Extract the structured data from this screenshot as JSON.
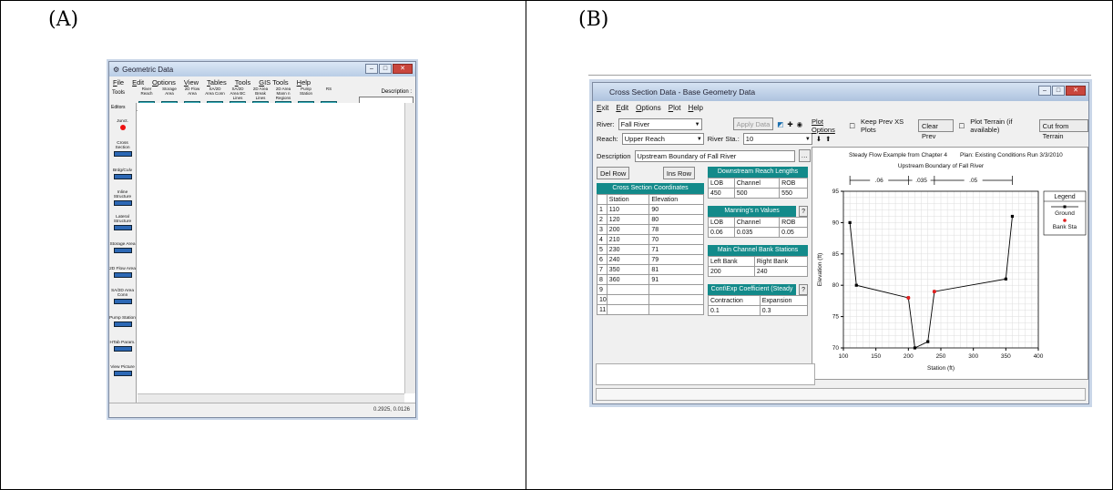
{
  "panel_a": {
    "label": "(A)",
    "title": "Geometric Data",
    "menu": [
      "File",
      "Edit",
      "Options",
      "View",
      "Tables",
      "Tools",
      "GIS Tools",
      "Help"
    ],
    "tools_label": "Tools",
    "editors_label": "Editors",
    "toolbar": [
      "River Reach",
      "Storage Area",
      "2D Flow Area",
      "SA/2D Area Conn",
      "SA/2D Area BC Lines",
      "2D Area Break Lines",
      "2D Area Mann n Regions",
      "Pump Station",
      "RS"
    ],
    "description_label": "Description :",
    "left_tools": [
      "Junct.",
      "Cross Section",
      "Brdg/Culv",
      "Inline Structure",
      "Lateral Structure",
      "Storage Area",
      "2D Flow Area",
      "SA/2D Area Conn",
      "Pump Station",
      "HTab Param.",
      "View Picture"
    ],
    "status": "0.2925, 0.0126"
  },
  "panel_b": {
    "label": "(B)",
    "title": "Cross Section Data - Base Geometry Data",
    "menu": [
      "Exit",
      "Edit",
      "Options",
      "Plot",
      "Help"
    ],
    "river_label": "River:",
    "river": "Fall River",
    "reach_label": "Reach:",
    "reach": "Upper Reach",
    "river_sta_label": "River Sta.:",
    "river_sta": "10",
    "apply_data": "Apply Data",
    "plot_options": "Plot Options",
    "keep_prev": "Keep Prev XS Plots",
    "clear_prev": "Clear Prev",
    "plot_terrain": "Plot Terrain (if available)",
    "cut_terrain": "Cut from Terrain",
    "description_label": "Description",
    "description": "Upstream Boundary of Fall River",
    "del_row": "Del Row",
    "ins_row": "Ins Row",
    "xs_coords_title": "Cross Section Coordinates",
    "xs_headers": [
      "Station",
      "Elevation"
    ],
    "xs_rows": [
      [
        "1",
        "110",
        "90"
      ],
      [
        "2",
        "120",
        "80"
      ],
      [
        "3",
        "200",
        "78"
      ],
      [
        "4",
        "210",
        "70"
      ],
      [
        "5",
        "230",
        "71"
      ],
      [
        "6",
        "240",
        "79"
      ],
      [
        "7",
        "350",
        "81"
      ],
      [
        "8",
        "360",
        "91"
      ],
      [
        "9",
        "",
        ""
      ],
      [
        "10",
        "",
        ""
      ],
      [
        "11",
        "",
        ""
      ]
    ],
    "reach_lengths_title": "Downstream Reach Lengths",
    "reach_length_headers": [
      "LOB",
      "Channel",
      "ROB"
    ],
    "reach_length_values": [
      "450",
      "500",
      "550"
    ],
    "mannings_title": "Manning's n Values",
    "mannings_headers": [
      "LOB",
      "Channel",
      "ROB"
    ],
    "mannings_values": [
      "0.06",
      "0.035",
      "0.05"
    ],
    "bank_title": "Main Channel Bank Stations",
    "bank_headers": [
      "Left Bank",
      "Right Bank"
    ],
    "bank_values": [
      "200",
      "240"
    ],
    "coef_title": "Cont\\Exp Coefficient (Steady",
    "coef_headers": [
      "Contraction",
      "Expansion"
    ],
    "coef_values": [
      "0.1",
      "0.3"
    ],
    "colors": {
      "teal": "#138a8a",
      "ground": "#000000",
      "bank": "#e02020"
    }
  },
  "chart_data": {
    "type": "line",
    "title": "Upstream Boundary of Fall River",
    "subtitle_left": "Steady Flow Example from Chapter 4",
    "subtitle_right": "Plan: Existing Conditions Run  3/3/2010",
    "xlabel": "Station (ft)",
    "ylabel": "Elevation (ft)",
    "xlim": [
      100,
      400
    ],
    "ylim": [
      70,
      95
    ],
    "xticks": [
      100,
      150,
      200,
      250,
      300,
      350,
      400
    ],
    "yticks": [
      70,
      75,
      80,
      85,
      90,
      95
    ],
    "grid": true,
    "legend_title": "Legend",
    "legend_position": "right",
    "series": [
      {
        "name": "Ground",
        "x": [
          110,
          120,
          200,
          210,
          230,
          240,
          350,
          360
        ],
        "y": [
          90,
          80,
          78,
          70,
          71,
          79,
          81,
          91
        ]
      },
      {
        "name": "Bank Sta",
        "x": [
          200,
          240
        ],
        "y": [
          78,
          79
        ]
      }
    ],
    "n_values": [
      ".06",
      ".035",
      ".05"
    ],
    "n_breaks": [
      110,
      200,
      240,
      360
    ]
  }
}
